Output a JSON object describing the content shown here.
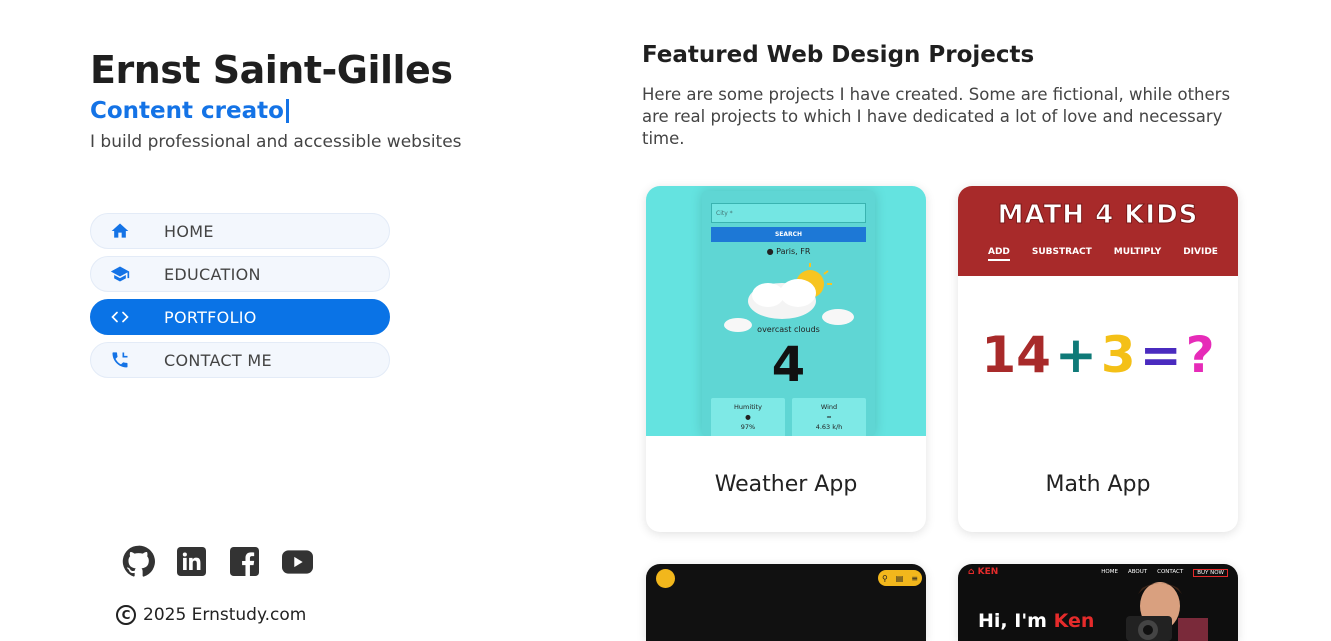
{
  "profile": {
    "name": "Ernst Saint-Gilles",
    "role": "Content creato",
    "tagline": "I build professional and accessible websites"
  },
  "nav": {
    "items": [
      {
        "label": "HOME",
        "icon": "home-icon"
      },
      {
        "label": "EDUCATION",
        "icon": "graduation-cap-icon"
      },
      {
        "label": "PORTFOLIO",
        "icon": "code-icon",
        "active": true
      },
      {
        "label": "CONTACT ME",
        "icon": "phone-icon"
      }
    ]
  },
  "social": [
    "github-icon",
    "linkedin-icon",
    "facebook-icon",
    "youtube-icon"
  ],
  "footer": {
    "copyright": "2025 Ernstudy.com"
  },
  "projects": {
    "heading": "Featured Web Design Projects",
    "intro": "Here are some projects I have created. Some are fictional, while others are real projects to which I have dedicated a lot of love and necessary time.",
    "cards": [
      {
        "title": "Weather App",
        "preview": {
          "city_placeholder": "City *",
          "search_label": "SEARCH",
          "location": "Paris, FR",
          "description": "overcast clouds",
          "temperature": "4",
          "humidity_label": "Humitity",
          "humidity_value": "97%",
          "wind_label": "Wind",
          "wind_value": "4.63 k/h"
        }
      },
      {
        "title": "Math App",
        "preview": {
          "logo": "MATH 4 KIDS",
          "tabs": [
            "ADD",
            "SUBSTRACT",
            "MULTIPLY",
            "DIVIDE"
          ],
          "equation": [
            "14",
            "+",
            "3",
            "=",
            "?"
          ]
        }
      },
      {
        "title": ""
      },
      {
        "title": "",
        "preview": {
          "brand": "KEN",
          "menu": [
            "HOME",
            "ABOUT",
            "CONTACT",
            "BUY NOW"
          ],
          "hero_prefix": "Hi, I'm",
          "hero_name": "Ken"
        }
      }
    ]
  },
  "colors": {
    "accent": "#1473e6",
    "active_nav": "#0a73e6",
    "weather_bg": "#64e3e0",
    "math_header": "#a82a2a"
  }
}
